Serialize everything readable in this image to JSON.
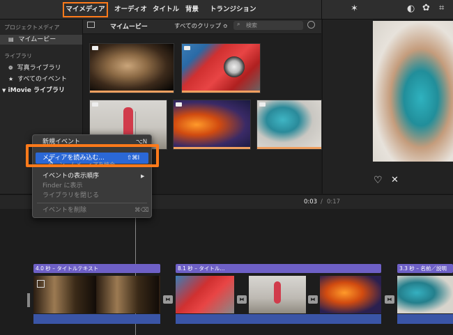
{
  "toolbar": {
    "tabs": [
      "マイメディア",
      "オーディオ",
      "タイトル",
      "背景",
      "トランジション"
    ],
    "active_tab": "マイメディア",
    "accent": "#ff7a1a"
  },
  "sidebar": {
    "project_media_heading": "プロジェクトメディア",
    "my_movie": "マイムービー",
    "library_heading": "ライブラリ",
    "items": [
      "写真ライブラリ",
      "すべてのイベント",
      "iMovie ライブラリ"
    ]
  },
  "browser": {
    "title": "マイムービー",
    "filter": "すべてのクリップ ≎",
    "search_placeholder": "検索"
  },
  "context_menu": {
    "items": [
      {
        "label": "新規イベント",
        "shortcut": "⌥N",
        "enabled": true
      },
      {
        "label": "メディアを読み込む...",
        "shortcut": "⇧⌘I",
        "enabled": true,
        "highlighted": true
      },
      {
        "label": "…タ…ン…ムメ…ィアを統合",
        "shortcut": "",
        "enabled": true
      },
      {
        "label": "イベントの表示順序",
        "shortcut": "▶",
        "enabled": true
      },
      {
        "label": "Finder に表示",
        "shortcut": "",
        "enabled": false
      },
      {
        "label": "ライブラリを閉じる",
        "shortcut": "",
        "enabled": false
      },
      {
        "label": "イベントを削除",
        "shortcut": "⌘⌫",
        "enabled": false
      }
    ],
    "highlight_color": "#2b68d6"
  },
  "timecode": {
    "current": "0:03",
    "separator": "/",
    "total": "0:17"
  },
  "timeline": {
    "titles": [
      "4.0 秒 – タイトルテキスト",
      "8.1 秒 – タイトル...",
      "3.3 秒 – 名前／説明"
    ],
    "title_color": "#6e60c6"
  }
}
